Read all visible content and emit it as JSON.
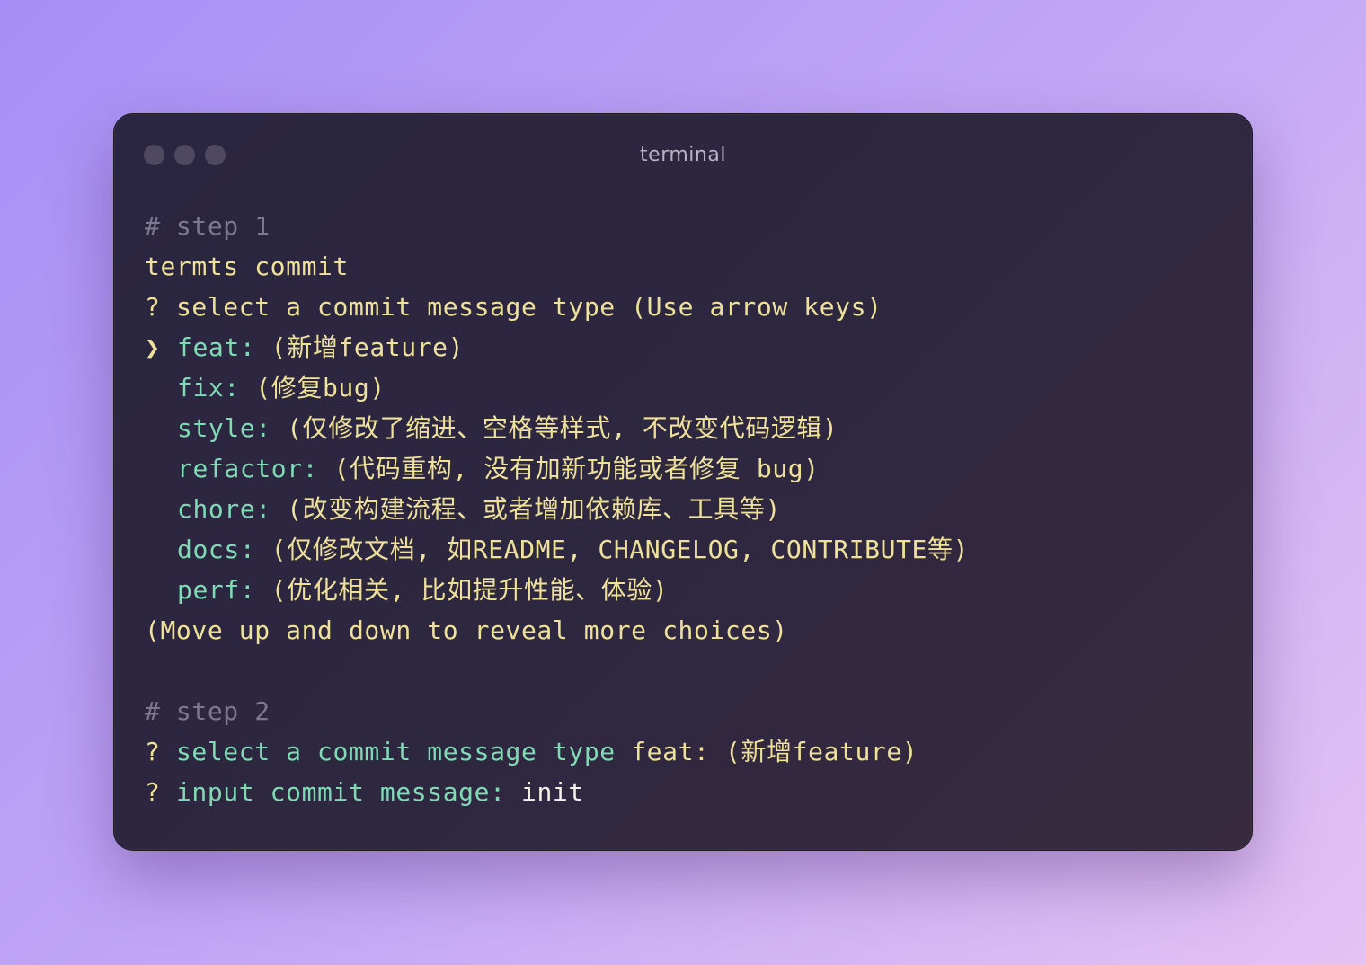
{
  "window": {
    "title": "terminal"
  },
  "step1": {
    "comment": "# step 1",
    "command": "termts commit",
    "prompt_mark": "?",
    "prompt": "select a commit message type (Use arrow keys)",
    "pointer": "❯",
    "options": [
      {
        "key": "feat:",
        "desc": "(新增feature)",
        "selected": true
      },
      {
        "key": "fix:",
        "desc": "(修复bug)",
        "selected": false
      },
      {
        "key": "style:",
        "desc": "(仅修改了缩进、空格等样式, 不改变代码逻辑)",
        "selected": false
      },
      {
        "key": "refactor:",
        "desc": "(代码重构, 没有加新功能或者修复 bug)",
        "selected": false
      },
      {
        "key": "chore:",
        "desc": "(改变构建流程、或者增加依赖库、工具等)",
        "selected": false
      },
      {
        "key": "docs:",
        "desc": "(仅修改文档, 如README, CHANGELOG, CONTRIBUTE等)",
        "selected": false
      },
      {
        "key": "perf:",
        "desc": "(优化相关, 比如提升性能、体验)",
        "selected": false
      }
    ],
    "hint": "(Move up and down to reveal more choices)"
  },
  "step2": {
    "comment": "# step 2",
    "line1_mark": "?",
    "line1_label": "select a commit message type",
    "line1_value": "feat: (新增feature)",
    "line2_mark": "?",
    "line2_label": "input commit message:",
    "line2_value": "init"
  },
  "colors": {
    "comment": "#7d7892",
    "yellow": "#eee19a",
    "green": "#7fdab5",
    "window_bg": "#2e2740"
  }
}
